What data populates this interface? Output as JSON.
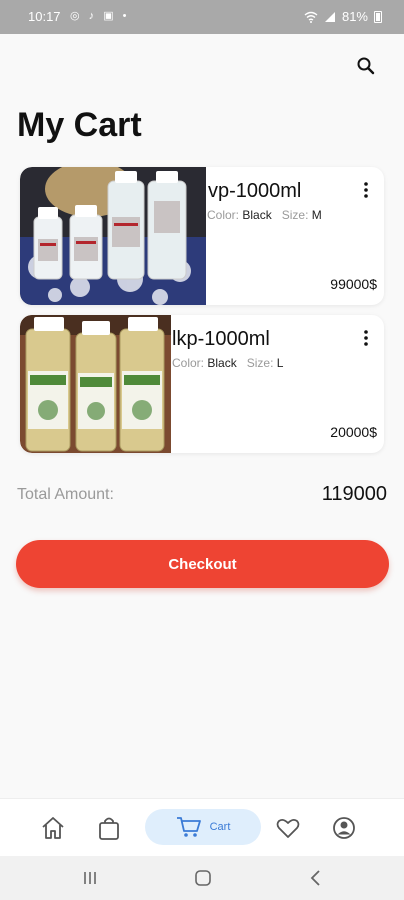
{
  "status_bar": {
    "time": "10:17",
    "notifications": "◎ ♪ ▣ •",
    "battery_text": "81%"
  },
  "header": {
    "title": "My Cart"
  },
  "cart": {
    "items": [
      {
        "name": "vp-1000ml",
        "color_label": "Color:",
        "color_value": "Black",
        "size_label": "Size:",
        "size_value": "M",
        "price": "99000$"
      },
      {
        "name": "lkp-1000ml",
        "color_label": "Color:",
        "color_value": "Black",
        "size_label": "Size:",
        "size_value": "L",
        "price": "20000$"
      }
    ]
  },
  "summary": {
    "total_label": "Total Amount:",
    "total_value": "119000"
  },
  "checkout": {
    "label": "Checkout"
  },
  "bottom_nav": {
    "active": "cart",
    "items": [
      {
        "icon": "home-icon"
      },
      {
        "icon": "shopping-bag-icon"
      },
      {
        "icon": "cart-icon",
        "label": "Cart"
      },
      {
        "icon": "heart-icon"
      },
      {
        "icon": "profile-icon"
      }
    ]
  },
  "colors": {
    "accent": "#ee4433",
    "nav_active_bg": "#dfeefc",
    "nav_active_fg": "#3b7bd6"
  }
}
